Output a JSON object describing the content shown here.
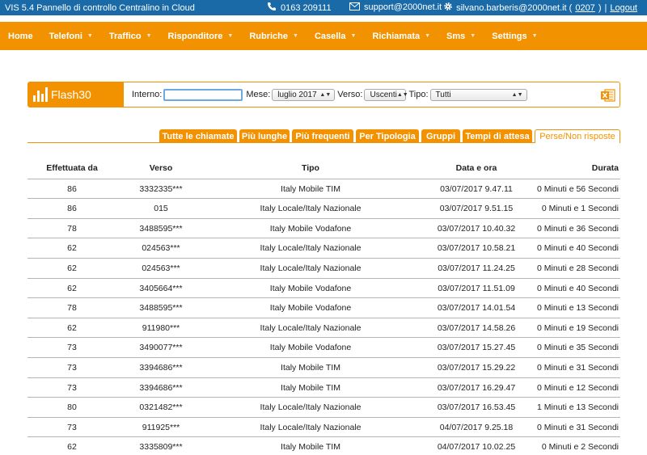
{
  "topbar": {
    "title": "VIS 5.4 Pannello di controllo Centralino in Cloud",
    "phone": "0163 209111",
    "email": "support@2000net.it",
    "user_prefix": "silvano.barberis@2000net.it (",
    "user_code": "0207",
    "user_suffix": ")",
    "separator": "|",
    "logout": "Logout"
  },
  "nav": [
    {
      "label": "Home",
      "has_menu": false
    },
    {
      "label": "Telefoni",
      "has_menu": true
    },
    {
      "label": "Traffico",
      "has_menu": true
    },
    {
      "label": "Risponditore",
      "has_menu": true
    },
    {
      "label": "Rubriche",
      "has_menu": true
    },
    {
      "label": "Casella",
      "has_menu": true
    },
    {
      "label": "Richiamata",
      "has_menu": true
    },
    {
      "label": "Sms",
      "has_menu": true
    },
    {
      "label": "Settings",
      "has_menu": true
    }
  ],
  "filters": {
    "logo": "Flash30",
    "interno_label": "Interno:",
    "interno_value": "",
    "mese_label": "Mese:",
    "mese_value": "luglio 2017",
    "verso_label": "Verso:",
    "verso_value": "Uscenti",
    "tipo_label": "Tipo:",
    "tipo_value": "Tutti"
  },
  "tabs": [
    {
      "label": "Tutte le chiamate",
      "active": false
    },
    {
      "label": "Più lunghe",
      "active": false
    },
    {
      "label": "Più frequenti",
      "active": false
    },
    {
      "label": "Per Tipologia",
      "active": false
    },
    {
      "label": "Gruppi",
      "active": false
    },
    {
      "label": "Tempi di attesa",
      "active": false
    },
    {
      "label": "Perse/Non risposte",
      "active": true
    }
  ],
  "table": {
    "columns": [
      "Effettuata da",
      "Verso",
      "Tipo",
      "Data e ora",
      "Durata"
    ],
    "rows": [
      [
        "86",
        "3332335***",
        "Italy Mobile TIM",
        "03/07/2017 9.47.11",
        "0 Minuti e 56 Secondi"
      ],
      [
        "86",
        "015",
        "Italy Locale/Italy Nazionale",
        "03/07/2017 9.51.15",
        "0 Minuti e 1 Secondi"
      ],
      [
        "78",
        "3488595***",
        "Italy Mobile Vodafone",
        "03/07/2017 10.40.32",
        "0 Minuti e 36 Secondi"
      ],
      [
        "62",
        "024563***",
        "Italy Locale/Italy Nazionale",
        "03/07/2017 10.58.21",
        "0 Minuti e 40 Secondi"
      ],
      [
        "62",
        "024563***",
        "Italy Locale/Italy Nazionale",
        "03/07/2017 11.24.25",
        "0 Minuti e 28 Secondi"
      ],
      [
        "62",
        "3405664***",
        "Italy Mobile Vodafone",
        "03/07/2017 11.51.09",
        "0 Minuti e 40 Secondi"
      ],
      [
        "78",
        "3488595***",
        "Italy Mobile Vodafone",
        "03/07/2017 14.01.54",
        "0 Minuti e 13 Secondi"
      ],
      [
        "62",
        "911980***",
        "Italy Locale/Italy Nazionale",
        "03/07/2017 14.58.26",
        "0 Minuti e 19 Secondi"
      ],
      [
        "73",
        "3490077***",
        "Italy Mobile Vodafone",
        "03/07/2017 15.27.45",
        "0 Minuti e 35 Secondi"
      ],
      [
        "73",
        "3394686***",
        "Italy Mobile TIM",
        "03/07/2017 15.29.22",
        "0 Minuti e 31 Secondi"
      ],
      [
        "73",
        "3394686***",
        "Italy Mobile TIM",
        "03/07/2017 16.29.47",
        "0 Minuti e 12 Secondi"
      ],
      [
        "80",
        "0321482***",
        "Italy Locale/Italy Nazionale",
        "03/07/2017 16.53.45",
        "1 Minuti e 13 Secondi"
      ],
      [
        "73",
        "911925***",
        "Italy Locale/Italy Nazionale",
        "04/07/2017 9.25.18",
        "0 Minuti e 31 Secondi"
      ],
      [
        "62",
        "3335809***",
        "Italy Mobile TIM",
        "04/07/2017 10.02.25",
        "0 Minuti e 2 Secondi"
      ]
    ]
  },
  "colors": {
    "topbar": "#1b6aa8",
    "accent": "#f39200"
  }
}
